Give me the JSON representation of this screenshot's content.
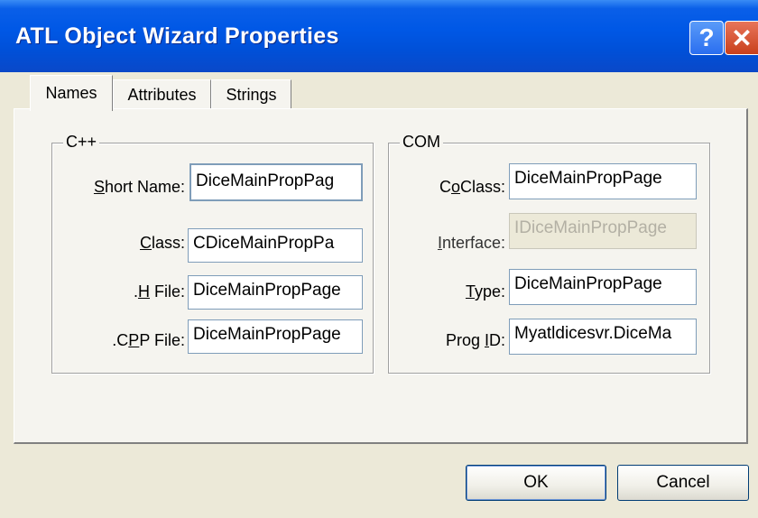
{
  "window": {
    "title": "ATL Object Wizard Properties",
    "help_glyph": "?",
    "close_glyph": "✕"
  },
  "tabs": [
    {
      "label": "Names",
      "active": true
    },
    {
      "label": "Attributes",
      "active": false
    },
    {
      "label": "Strings",
      "active": false
    }
  ],
  "cpp_group": {
    "legend": "C++",
    "fields": [
      {
        "label_pre": "",
        "label_key": "S",
        "label_post": "hort Name:",
        "value": "DiceMainPropPag"
      },
      {
        "label_pre": "",
        "label_key": "C",
        "label_post": "lass:",
        "value": "CDiceMainPropPa"
      },
      {
        "label_pre": ".",
        "label_key": "H",
        "label_post": " File:",
        "value": "DiceMainPropPage"
      },
      {
        "label_pre": ".C",
        "label_key": "P",
        "label_post": "P File:",
        "value": "DiceMainPropPage"
      }
    ]
  },
  "com_group": {
    "legend": "COM",
    "fields": [
      {
        "label_pre": "C",
        "label_key": "o",
        "label_post": "Class:",
        "value": "DiceMainPropPage"
      },
      {
        "label_pre": "",
        "label_key": "I",
        "label_post": "nterface:",
        "value": "IDiceMainPropPage"
      },
      {
        "label_pre": "",
        "label_key": "T",
        "label_post": "ype:",
        "value": "DiceMainPropPage"
      },
      {
        "label_pre": "Prog ",
        "label_key": "I",
        "label_post": "D:",
        "value": "Myatldicesvr.DiceMa"
      }
    ]
  },
  "buttons": {
    "ok": "OK",
    "cancel": "Cancel"
  }
}
